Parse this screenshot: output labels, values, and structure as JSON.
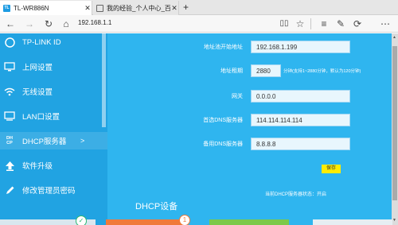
{
  "tabs": [
    {
      "title": "TL-WR886N",
      "active": true
    },
    {
      "title": "我的经验_个人中心_百度经验",
      "active": false
    }
  ],
  "address": {
    "url": "192.168.1.1"
  },
  "sidebar": {
    "items": [
      {
        "label": "TP-LINK ID",
        "icon": "tp-link-id-icon"
      },
      {
        "label": "上网设置",
        "icon": "internet-settings-icon"
      },
      {
        "label": "无线设置",
        "icon": "wifi-icon"
      },
      {
        "label": "LAN口设置",
        "icon": "lan-icon"
      },
      {
        "label": "DHCP服务器",
        "icon": "dhcp-icon",
        "arrow": ">"
      },
      {
        "label": "软件升级",
        "icon": "upload-icon"
      },
      {
        "label": "修改管理员密码",
        "icon": "pencil-icon"
      }
    ]
  },
  "form": {
    "start_label": "地址池开始地址",
    "start_value": "192.168.1.199",
    "lease_label": "地址租期",
    "lease_value": "2880",
    "lease_hint": "分钟(支持1~2880分钟，默认为120分钟)",
    "gateway_label": "网关",
    "gateway_value": "0.0.0.0",
    "dns1_label": "首选DNS服务器",
    "dns1_value": "114.114.114.114",
    "dns2_label": "备用DNS服务器",
    "dns2_value": "8.8.8.8",
    "save_label": "保存",
    "status_text": "当前DHCP服务器状态：开启"
  },
  "section_title": "DHCP设备",
  "bottom_cards": {
    "badge_number": "1"
  },
  "colors": {
    "sidebar": "#21a3e2",
    "main": "#2fb5ef",
    "save": "#ffec00"
  }
}
